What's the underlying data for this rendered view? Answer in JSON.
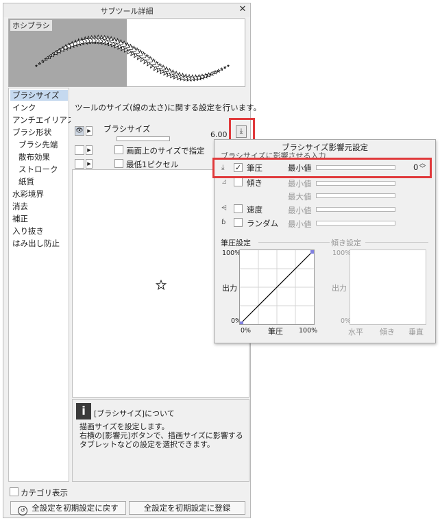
{
  "window": {
    "title": "サブツール詳細",
    "close": "✕"
  },
  "preview": {
    "label": "ホシブラシ"
  },
  "categories": [
    {
      "label": "ブラシサイズ",
      "selected": true
    },
    {
      "label": "インク"
    },
    {
      "label": "アンチエイリアス"
    },
    {
      "label": "ブラシ形状"
    },
    {
      "label": "ブラシ先端",
      "sub": true
    },
    {
      "label": "散布効果",
      "sub": true
    },
    {
      "label": "ストローク",
      "sub": true
    },
    {
      "label": "紙質",
      "sub": true
    },
    {
      "label": "水彩境界"
    },
    {
      "label": "消去"
    },
    {
      "label": "補正"
    },
    {
      "label": "入り抜き"
    },
    {
      "label": "はみ出し防止"
    }
  ],
  "settings": {
    "description": "ツールのサイズ(線の太さ)に関する設定を行います。",
    "brush_size_label": "ブラシサイズ",
    "brush_size_value": "6.00",
    "screen_size_label": "画面上のサイズで指定",
    "min_1px_label": "最低1ピクセル"
  },
  "help": {
    "icon": "i",
    "title": "[ブラシサイズ]について",
    "body": "描画サイズを設定します。\n右横の[影響元]ボタンで、描画サイズに影響するタブレットなどの設定を選択できます。"
  },
  "footer": {
    "category_display": "カテゴリ表示",
    "reset_button": "全設定を初期設定に戻す",
    "register_button": "全設定を初期設定に登録"
  },
  "popup": {
    "title": "ブラシサイズ影響元設定",
    "subtitle": "ブラシサイズに影響させる入力",
    "rows": [
      {
        "label": "筆圧",
        "checked": true,
        "checkmark": "✓",
        "min": "最小値",
        "value": "0"
      },
      {
        "label": "傾き",
        "min": "最小値",
        "max": "最大値"
      },
      {
        "label": "速度",
        "min": "最小値"
      },
      {
        "label": "ランダム",
        "min": "最小値"
      }
    ],
    "pressure_section": "筆圧設定",
    "tilt_section": "傾き設定",
    "graph1": {
      "y_top": "100%",
      "y_bottom": "0%",
      "y_label": "出力",
      "x_left": "0%",
      "x_mid": "筆圧",
      "x_right": "100%"
    },
    "graph2": {
      "y_top": "100%",
      "y_bottom": "0%",
      "y_label": "出力",
      "x_1": "水平",
      "x_2": "傾き",
      "x_3": "垂直"
    }
  },
  "colors": {
    "highlight": "#e0393b",
    "selection": "#c5d9ef"
  }
}
